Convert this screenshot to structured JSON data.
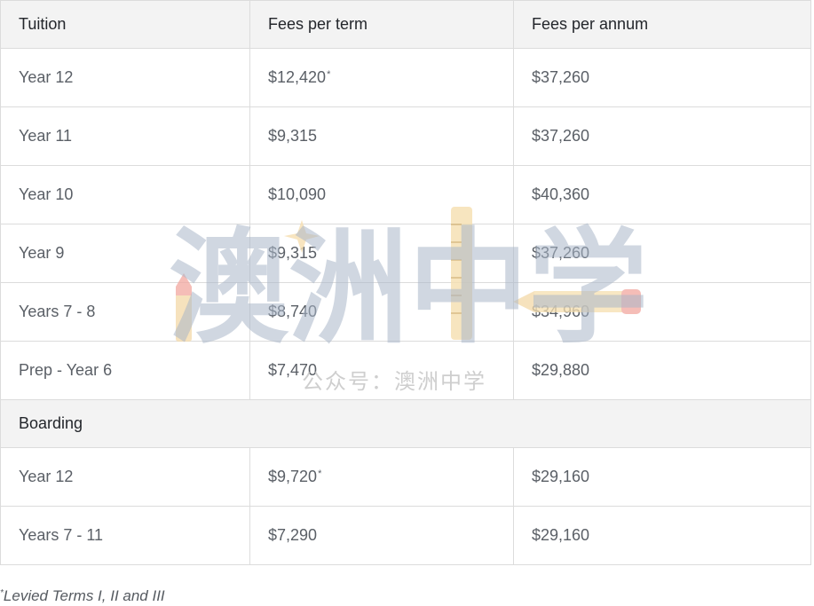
{
  "table": {
    "headers": [
      "Tuition",
      "Fees per term",
      "Fees per annum"
    ],
    "tuition_rows": [
      {
        "level": "Year 12",
        "term": "$12,420",
        "term_mark": "*",
        "annum": "$37,260"
      },
      {
        "level": "Year 11",
        "term": "$9,315",
        "term_mark": "",
        "annum": "$37,260"
      },
      {
        "level": "Year 10",
        "term": "$10,090",
        "term_mark": "",
        "annum": "$40,360"
      },
      {
        "level": "Year 9",
        "term": "$9,315",
        "term_mark": "",
        "annum": "$37,260"
      },
      {
        "level": "Years 7 - 8",
        "term": "$8,740",
        "term_mark": "",
        "annum": "$34,960"
      },
      {
        "level": "Prep - Year 6",
        "term": "$7,470",
        "term_mark": "",
        "annum": "$29,880"
      }
    ],
    "boarding_label": "Boarding",
    "boarding_rows": [
      {
        "level": "Year 12",
        "term": "$9,720",
        "term_mark": "*",
        "annum": "$29,160"
      },
      {
        "level": "Years 7 - 11",
        "term": "$7,290",
        "term_mark": "",
        "annum": "$29,160"
      }
    ]
  },
  "footnote": {
    "mark": "*",
    "text": "Levied Terms I, II and III"
  },
  "watermark": {
    "main": "澳洲中学",
    "sub": "公众号：澳洲中学",
    "colors": {
      "text": "#aab6c8",
      "pencil_body": "#f4d9a8",
      "pencil_tip": "#f2a7a0",
      "ruler": "#f6dfb0"
    }
  }
}
